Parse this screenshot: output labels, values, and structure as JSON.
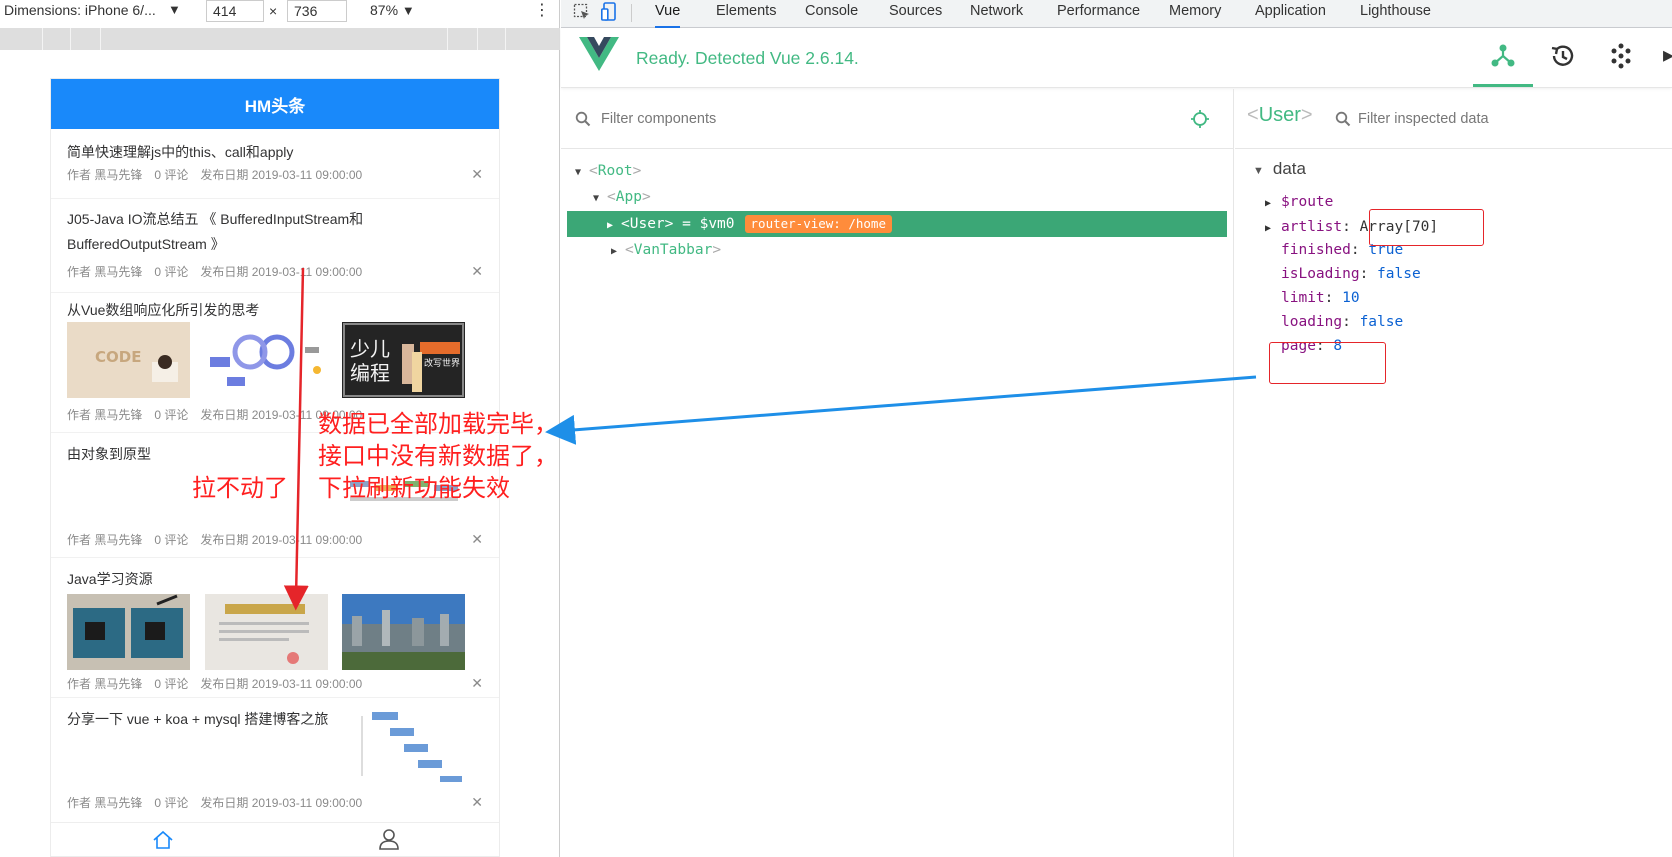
{
  "device_toolbar": {
    "dimensions_label": "Dimensions: iPhone 6/...",
    "width": "414",
    "times": "×",
    "height": "736",
    "zoom": "87%"
  },
  "phone": {
    "header_title": "HM头条",
    "articles": [
      {
        "title": "简单快速理解js中的this、call和apply",
        "author": "作者 黑马先锋",
        "comments": "0 评论",
        "date": "发布日期 2019-03-11 09:00:00"
      },
      {
        "title_line1": "J05-Java IO流总结五 《 BufferedInputStream和",
        "title_line2": "BufferedOutputStream 》",
        "author": "作者 黑马先锋",
        "comments": "0 评论",
        "date": "发布日期 2019-03-11 09:00:00"
      },
      {
        "title": "从Vue数组响应化所引发的思考",
        "author": "作者 黑马先锋",
        "comments": "0 评论",
        "date": "发布日期 2019-03-11 09:00:00",
        "thumb1_text": "CODE",
        "thumb3_text1": "少儿",
        "thumb3_text2": "编程",
        "thumb3_text3": "改写世界"
      },
      {
        "title": "由对象到原型",
        "author": "作者 黑马先锋",
        "comments": "0 评论",
        "date": "发布日期 2019-03-11 09:00:00"
      },
      {
        "title": "Java学习资源",
        "author": "作者 黑马先锋",
        "comments": "0 评论",
        "date": "发布日期 2019-03-11 09:00:00"
      },
      {
        "title": "分享一下 vue + koa + mysql 搭建博客之旅",
        "author": "作者 黑马先锋",
        "comments": "0 评论",
        "date": "发布日期 2019-03-11 09:00:00"
      }
    ],
    "tabbar_icons": [
      "home-icon",
      "user-icon"
    ]
  },
  "devtools": {
    "tabs": [
      "Vue",
      "Elements",
      "Console",
      "Sources",
      "Network",
      "Performance",
      "Memory",
      "Application",
      "Lighthouse"
    ],
    "active_tab": "Vue",
    "vue_status": "Ready. Detected Vue 2.6.14.",
    "component_filter_placeholder": "Filter components",
    "tree": {
      "root": "Root",
      "app": "App",
      "user": "User",
      "user_ref": "= $vm0",
      "router_badge": "router-view: /home",
      "tabbar": "VanTabbar"
    },
    "inspector": {
      "component_name": "User",
      "filter_placeholder": "Filter inspected data",
      "section": "data",
      "props": [
        {
          "key": "$route",
          "value": ""
        },
        {
          "key": "artlist",
          "value": "Array[70]"
        },
        {
          "key": "finished",
          "value": "true"
        },
        {
          "key": "isLoading",
          "value": "false"
        },
        {
          "key": "limit",
          "value": "10"
        },
        {
          "key": "loading",
          "value": "false"
        },
        {
          "key": "page",
          "value": "8"
        }
      ]
    }
  },
  "annotations": {
    "cannot_pull": "拉不动了",
    "message_line1": "数据已全部加载完毕，",
    "message_line2": "接口中没有新数据了，",
    "message_line3": "下拉刷新功能失效"
  },
  "colors": {
    "vue_green": "#42b983",
    "selected_row": "#3ba776",
    "router_badge": "#ff8c3b",
    "phone_header": "#1989fa",
    "annotation_red": "#ff1f1f",
    "annotation_arrow_blue": "#1e8fe8"
  }
}
